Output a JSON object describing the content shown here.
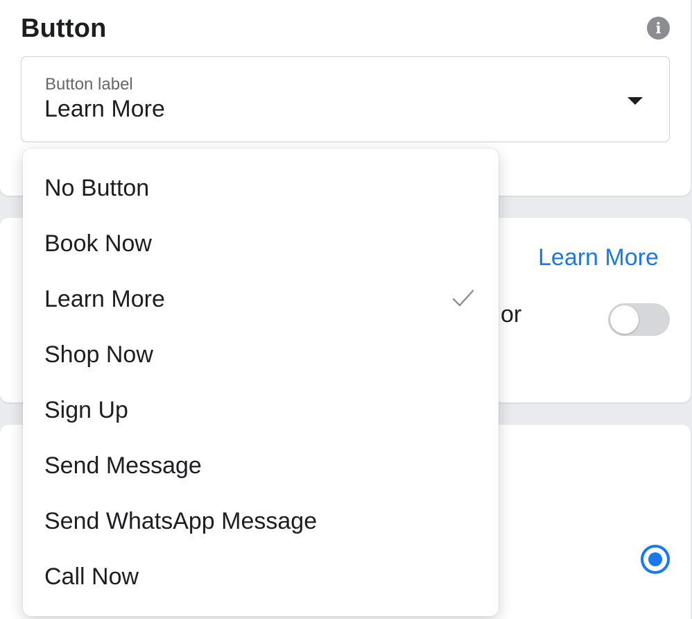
{
  "button_section": {
    "title": "Button",
    "info_icon": "info-icon",
    "select": {
      "label": "Button label",
      "value": "Learn More",
      "caret_icon": "caret-down-icon"
    }
  },
  "link_card": {
    "link_text": "Learn More",
    "partial_text": "or",
    "toggle_on": false
  },
  "radio_card": {
    "radio_selected": true
  },
  "dropdown": {
    "selected_index": 2,
    "check_icon": "checkmark-icon",
    "items": [
      {
        "label": "No Button"
      },
      {
        "label": "Book Now"
      },
      {
        "label": "Learn More"
      },
      {
        "label": "Shop Now"
      },
      {
        "label": "Sign Up"
      },
      {
        "label": "Send Message"
      },
      {
        "label": "Send WhatsApp Message"
      },
      {
        "label": "Call Now"
      }
    ]
  },
  "colors": {
    "accent": "#1877f2",
    "page_background": "#e9ebee",
    "card_background": "#ffffff",
    "text_primary": "#1c1e21",
    "text_secondary": "#65676b",
    "check": "#8a8d91"
  }
}
